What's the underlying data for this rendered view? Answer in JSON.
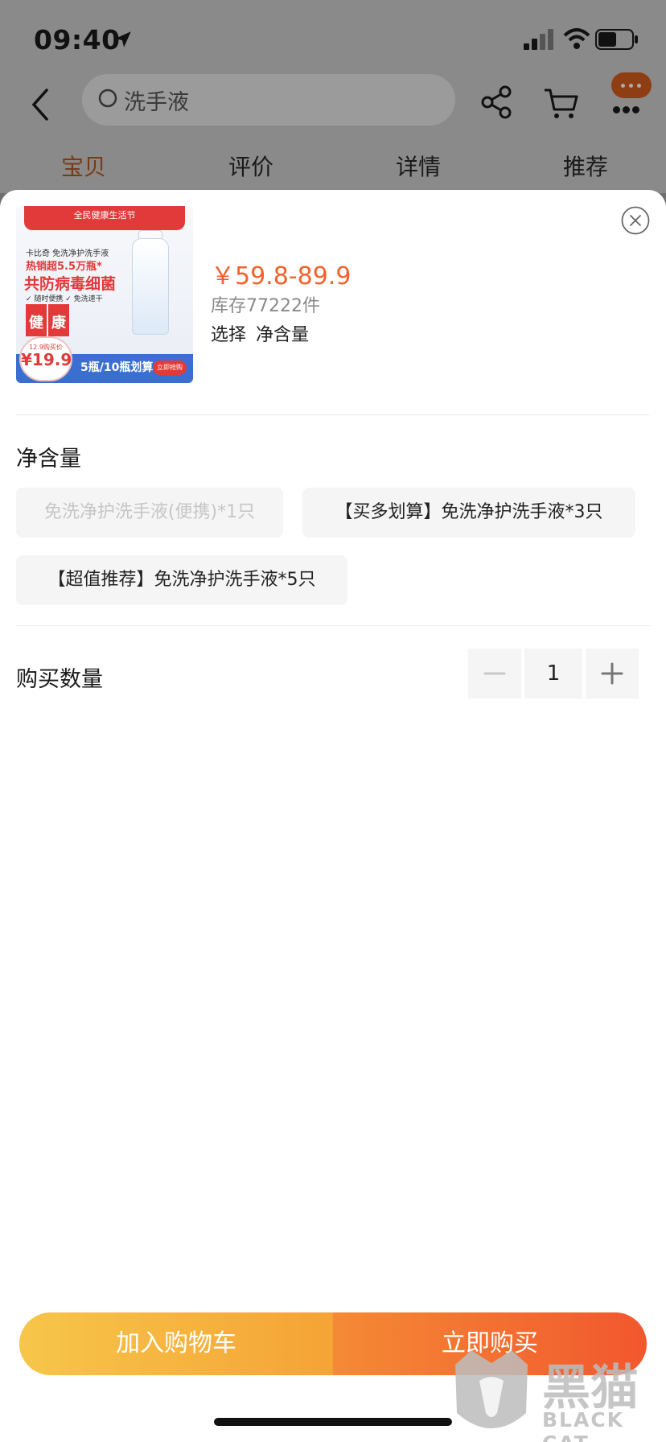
{
  "status_bar": {
    "time": "09:40"
  },
  "search": {
    "query": "洗手液"
  },
  "tabs": [
    {
      "label": "宝贝",
      "active": true
    },
    {
      "label": "评价",
      "active": false
    },
    {
      "label": "详情",
      "active": false
    },
    {
      "label": "推荐",
      "active": false
    }
  ],
  "product": {
    "price": "￥59.8-89.9",
    "stock": "库存77222件",
    "select_prefix": "选择",
    "select_spec": "净含量",
    "image": {
      "banner": "全民健康生活节",
      "line1": "卡比奇 免洗净护洗手液",
      "hot": "热销超5.5万瓶*",
      "headline": "共防病毒细菌",
      "subline": "✓ 随时便携 ✓ 免洗速干",
      "tag1": "健",
      "tag2": "康",
      "price_label": "12.9购买价",
      "price": "¥19.9",
      "strip_text": "5瓶/10瓶划算",
      "strip_btn": "立即抢购"
    }
  },
  "spec": {
    "title": "净含量",
    "options": [
      {
        "label": "免洗净护洗手液(便携)*1只",
        "disabled": true
      },
      {
        "label": "【买多划算】免洗净护洗手液*3只",
        "disabled": false
      },
      {
        "label": "【超值推荐】免洗净护洗手液*5只",
        "disabled": false
      }
    ]
  },
  "quantity": {
    "title": "购买数量",
    "value": "1"
  },
  "actions": {
    "add_to_cart": "加入购物车",
    "buy_now": "立即购买"
  },
  "watermark": {
    "cn": "黑猫",
    "en": "BLACK CAT"
  },
  "colors": {
    "accent": "#f2622b",
    "cart_btn": "#f5b03f",
    "buy_btn": "#f2572e"
  }
}
